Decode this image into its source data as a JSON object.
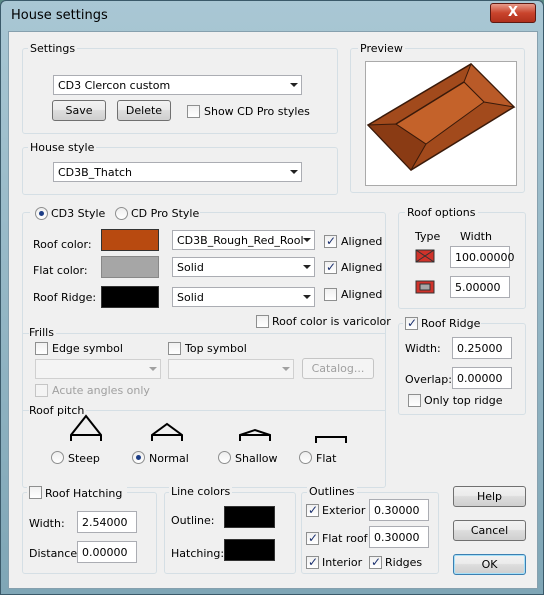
{
  "window": {
    "title": "House settings",
    "close_glyph": "X"
  },
  "settings": {
    "label": "Settings",
    "combo_value": "CD3 Clercon custom",
    "save_label": "Save",
    "delete_label": "Delete",
    "show_pro_label": "Show CD Pro styles"
  },
  "preview": {
    "label": "Preview"
  },
  "house_style": {
    "label": "House style",
    "value": "CD3B_Thatch"
  },
  "style": {
    "cd3_label": "CD3 Style",
    "pro_label": "CD Pro Style",
    "roof_color_label": "Roof color:",
    "roof_color_value": "CD3B_Rough_Red_Rool",
    "flat_color_label": "Flat color:",
    "flat_color_value": "Solid",
    "ridge_label": "Roof Ridge:",
    "ridge_value": "Solid",
    "aligned_label": "Aligned",
    "varicolor_label": "Roof color is varicolor",
    "roof_swatch": "#b84a10",
    "flat_swatch": "#a6a6a6",
    "ridge_swatch": "#000000"
  },
  "frills": {
    "label": "Frills",
    "edge_label": "Edge symbol",
    "top_label": "Top symbol",
    "catalog_label": "Catalog...",
    "acute_label": "Acute angles only"
  },
  "pitch": {
    "label": "Roof pitch",
    "steep": "Steep",
    "normal": "Normal",
    "shallow": "Shallow",
    "flat": "Flat"
  },
  "roof_options": {
    "label": "Roof options",
    "type_header": "Type",
    "width_header": "Width",
    "width1": "100.00000",
    "width2": "5.00000"
  },
  "ridge": {
    "label": "Roof Ridge",
    "width_label": "Width:",
    "width_value": "0.25000",
    "overlap_label": "Overlap:",
    "overlap_value": "0.00000",
    "only_top_label": "Only top ridge"
  },
  "hatching": {
    "label": "Roof Hatching",
    "width_label": "Width:",
    "width_value": "2.54000",
    "distance_label": "Distance:",
    "distance_value": "0.00000"
  },
  "line_colors": {
    "label": "Line colors",
    "outline_label": "Outline:",
    "hatching_label": "Hatching:"
  },
  "outlines": {
    "label": "Outlines",
    "exterior_label": "Exterior",
    "exterior_value": "0.30000",
    "flat_roof_label": "Flat roof",
    "flat_roof_value": "0.30000",
    "interior_label": "Interior",
    "ridges_label": "Ridges"
  },
  "buttons": {
    "help": "Help",
    "cancel": "Cancel",
    "ok": "OK"
  }
}
